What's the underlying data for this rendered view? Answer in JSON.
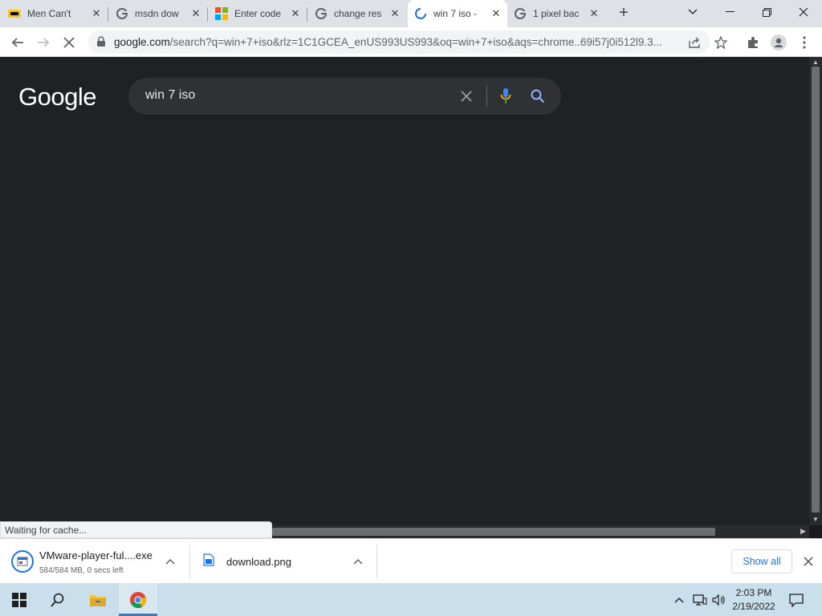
{
  "browser": {
    "tabs": [
      {
        "title": "Men Can't ",
        "favicon": "imdb-icon",
        "active": false
      },
      {
        "title": "msdn dow",
        "favicon": "google-icon",
        "active": false
      },
      {
        "title": "Enter code",
        "favicon": "microsoft-icon",
        "active": false
      },
      {
        "title": "change res",
        "favicon": "google-icon",
        "active": false
      },
      {
        "title": "win 7 iso -",
        "favicon": "loading-spinner-icon",
        "active": true
      },
      {
        "title": "1 pixel bac",
        "favicon": "google-icon",
        "active": false
      }
    ],
    "url_host": "google.com",
    "url_rest": "/search?q=win+7+iso&rlz=1C1GCEA_enUS993US993&oq=win+7+iso&aqs=chrome..69i57j0i512l9.3..."
  },
  "page": {
    "logo": "Google",
    "search_query": "win 7 iso",
    "status_text": "Waiting for cache..."
  },
  "downloads": {
    "items": [
      {
        "name": "VMware-player-ful....exe",
        "progress": "584/584 MB, 0 secs left"
      },
      {
        "name": "download.png",
        "progress": ""
      }
    ],
    "show_all": "Show all"
  },
  "taskbar": {
    "time": "2:03 PM",
    "date": "2/19/2022"
  },
  "colors": {
    "page_bg": "#202124",
    "search_bg": "#303134",
    "accent": "#1a73e8"
  }
}
